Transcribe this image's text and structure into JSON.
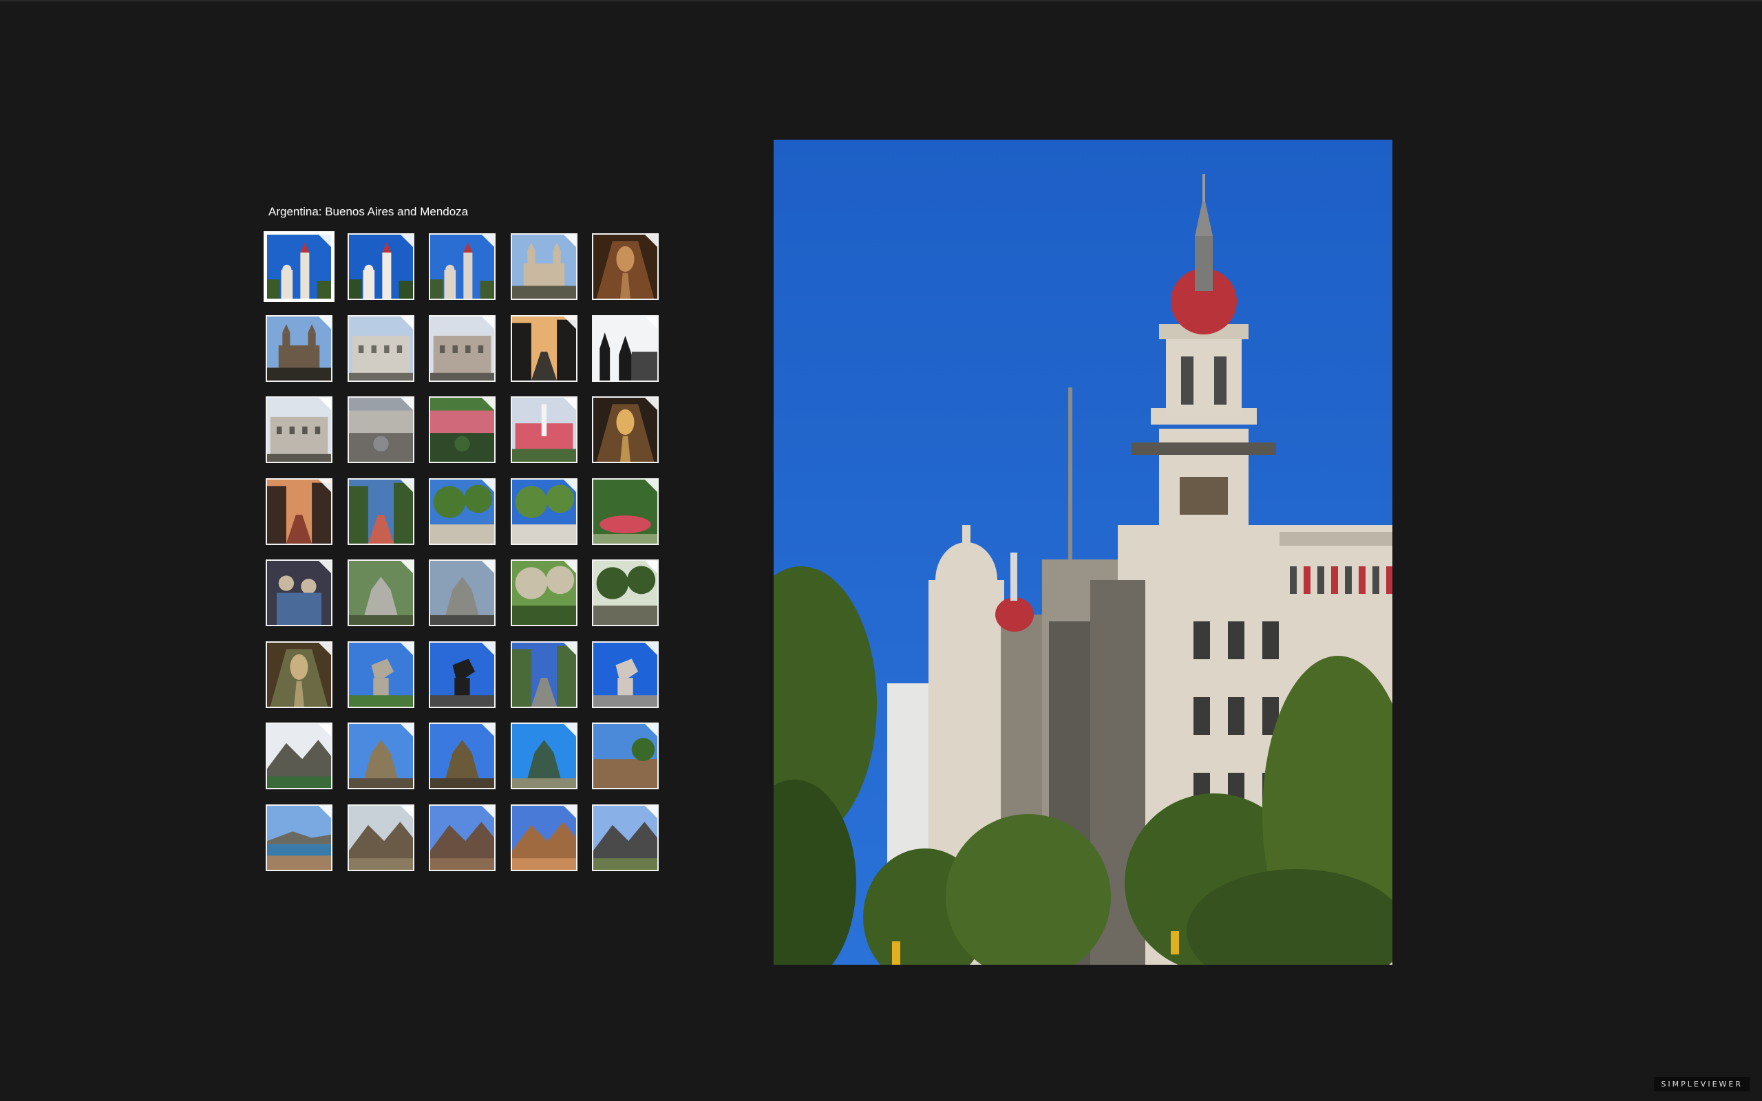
{
  "gallery": {
    "title": "Argentina: Buenos Aires and Mendoza",
    "selected_index": 0,
    "thumbnails": [
      {
        "subject": "tower",
        "colors": [
          "#1d63c9",
          "#e8e2d6",
          "#3b5a2a"
        ]
      },
      {
        "subject": "tower",
        "colors": [
          "#1b5fc6",
          "#f0ebe2",
          "#2f4e25"
        ]
      },
      {
        "subject": "tower",
        "colors": [
          "#2a6ed3",
          "#ddd6c8",
          "#3e5c30"
        ]
      },
      {
        "subject": "church",
        "colors": [
          "#8fb4e0",
          "#c8b9a0",
          "#5a5a4a"
        ]
      },
      {
        "subject": "interior",
        "colors": [
          "#3a2414",
          "#c8915a",
          "#7a4a28"
        ]
      },
      {
        "subject": "church",
        "colors": [
          "#7da7d8",
          "#6b5a48",
          "#2e2a24"
        ]
      },
      {
        "subject": "building",
        "colors": [
          "#b8cce4",
          "#d2cdc4",
          "#6a6a62"
        ]
      },
      {
        "subject": "building",
        "colors": [
          "#d8dee8",
          "#b0a598",
          "#5e5a54"
        ]
      },
      {
        "subject": "street",
        "colors": [
          "#e8b070",
          "#3a3632",
          "#1e1c1a"
        ]
      },
      {
        "subject": "silhouette",
        "colors": [
          "#f2f4f6",
          "#1a1a1a",
          "#444444"
        ]
      },
      {
        "subject": "building",
        "colors": [
          "#dde3ea",
          "#bdb7ad",
          "#5a5650"
        ]
      },
      {
        "subject": "plaza",
        "colors": [
          "#9aa0a8",
          "#b8b4ae",
          "#6e6a66"
        ]
      },
      {
        "subject": "plaza",
        "colors": [
          "#4a7a3c",
          "#d06a7a",
          "#2e4a28"
        ]
      },
      {
        "subject": "palace",
        "colors": [
          "#cfd8e4",
          "#d65a6a",
          "#4a6a3a"
        ]
      },
      {
        "subject": "interior",
        "colors": [
          "#2a2018",
          "#e0b060",
          "#6a4a2a"
        ]
      },
      {
        "subject": "street",
        "colors": [
          "#d89060",
          "#8a4030",
          "#3a2a22"
        ]
      },
      {
        "subject": "street",
        "colors": [
          "#4a7ab8",
          "#c86050",
          "#3a5a2c"
        ]
      },
      {
        "subject": "park",
        "colors": [
          "#3a7ad0",
          "#4a7a30",
          "#c8c0b0"
        ]
      },
      {
        "subject": "park",
        "colors": [
          "#2e6ed0",
          "#5a8a3a",
          "#d8d4cc"
        ]
      },
      {
        "subject": "fountain",
        "colors": [
          "#3a6a2e",
          "#d04a5a",
          "#8aa070"
        ]
      },
      {
        "subject": "people",
        "colors": [
          "#4a6a9a",
          "#c8b8a0",
          "#3a3a4a"
        ]
      },
      {
        "subject": "monument",
        "colors": [
          "#6a8a5a",
          "#b0b0a8",
          "#4a5a3a"
        ]
      },
      {
        "subject": "monument",
        "colors": [
          "#8aa0b8",
          "#8a8a84",
          "#4a4a48"
        ]
      },
      {
        "subject": "park",
        "colors": [
          "#6a9a4a",
          "#c8c0a8",
          "#3a5a2a"
        ]
      },
      {
        "subject": "park",
        "colors": [
          "#d8e0d0",
          "#3a5a2a",
          "#6a6a5a"
        ]
      },
      {
        "subject": "interior",
        "colors": [
          "#4a3a24",
          "#c8b080",
          "#6a6a44"
        ]
      },
      {
        "subject": "statue",
        "colors": [
          "#3a7ad8",
          "#b0a898",
          "#4a7a3a"
        ]
      },
      {
        "subject": "statue",
        "colors": [
          "#2a6ad8",
          "#1e1e1e",
          "#4a4a4a"
        ]
      },
      {
        "subject": "street",
        "colors": [
          "#3a6ac8",
          "#8a8a84",
          "#4a6a3a"
        ]
      },
      {
        "subject": "statue",
        "colors": [
          "#1e64d8",
          "#d0c8c0",
          "#8a8a8a"
        ]
      },
      {
        "subject": "mountain",
        "colors": [
          "#e8ecf0",
          "#5a5a50",
          "#3a6a3a"
        ]
      },
      {
        "subject": "monument",
        "colors": [
          "#4a8ae0",
          "#8a7a5a",
          "#5a5040"
        ]
      },
      {
        "subject": "monument",
        "colors": [
          "#3a7ae0",
          "#6a5a3a",
          "#4a4030"
        ]
      },
      {
        "subject": "monument",
        "colors": [
          "#2a8ae8",
          "#3a5a4a",
          "#8a8a70"
        ]
      },
      {
        "subject": "landscape",
        "colors": [
          "#4a8ad8",
          "#8a6a4a",
          "#3a6a2a"
        ]
      },
      {
        "subject": "lake",
        "colors": [
          "#7aa8e0",
          "#3a7aa8",
          "#a08060"
        ]
      },
      {
        "subject": "mountain",
        "colors": [
          "#c8d0d8",
          "#6a5a48",
          "#8a7a60"
        ]
      },
      {
        "subject": "mountain",
        "colors": [
          "#5a8ae0",
          "#6a5040",
          "#8a6a50"
        ]
      },
      {
        "subject": "mountain",
        "colors": [
          "#4a7ad8",
          "#a06a40",
          "#c88a58"
        ]
      },
      {
        "subject": "mountain",
        "colors": [
          "#8ab0e8",
          "#4a4a4a",
          "#6a7a4a"
        ]
      }
    ]
  },
  "main_photo": {
    "subject": "building-with-clock-tower",
    "colors": {
      "sky": "#1d5fc6",
      "building": "#ddd5c8",
      "shadow": "#8a8478",
      "dome": "#b8343a",
      "trees": "#3f5f22",
      "dark": "#2a2a28"
    }
  },
  "brand": {
    "label": "SIMPLEVIEWER"
  }
}
